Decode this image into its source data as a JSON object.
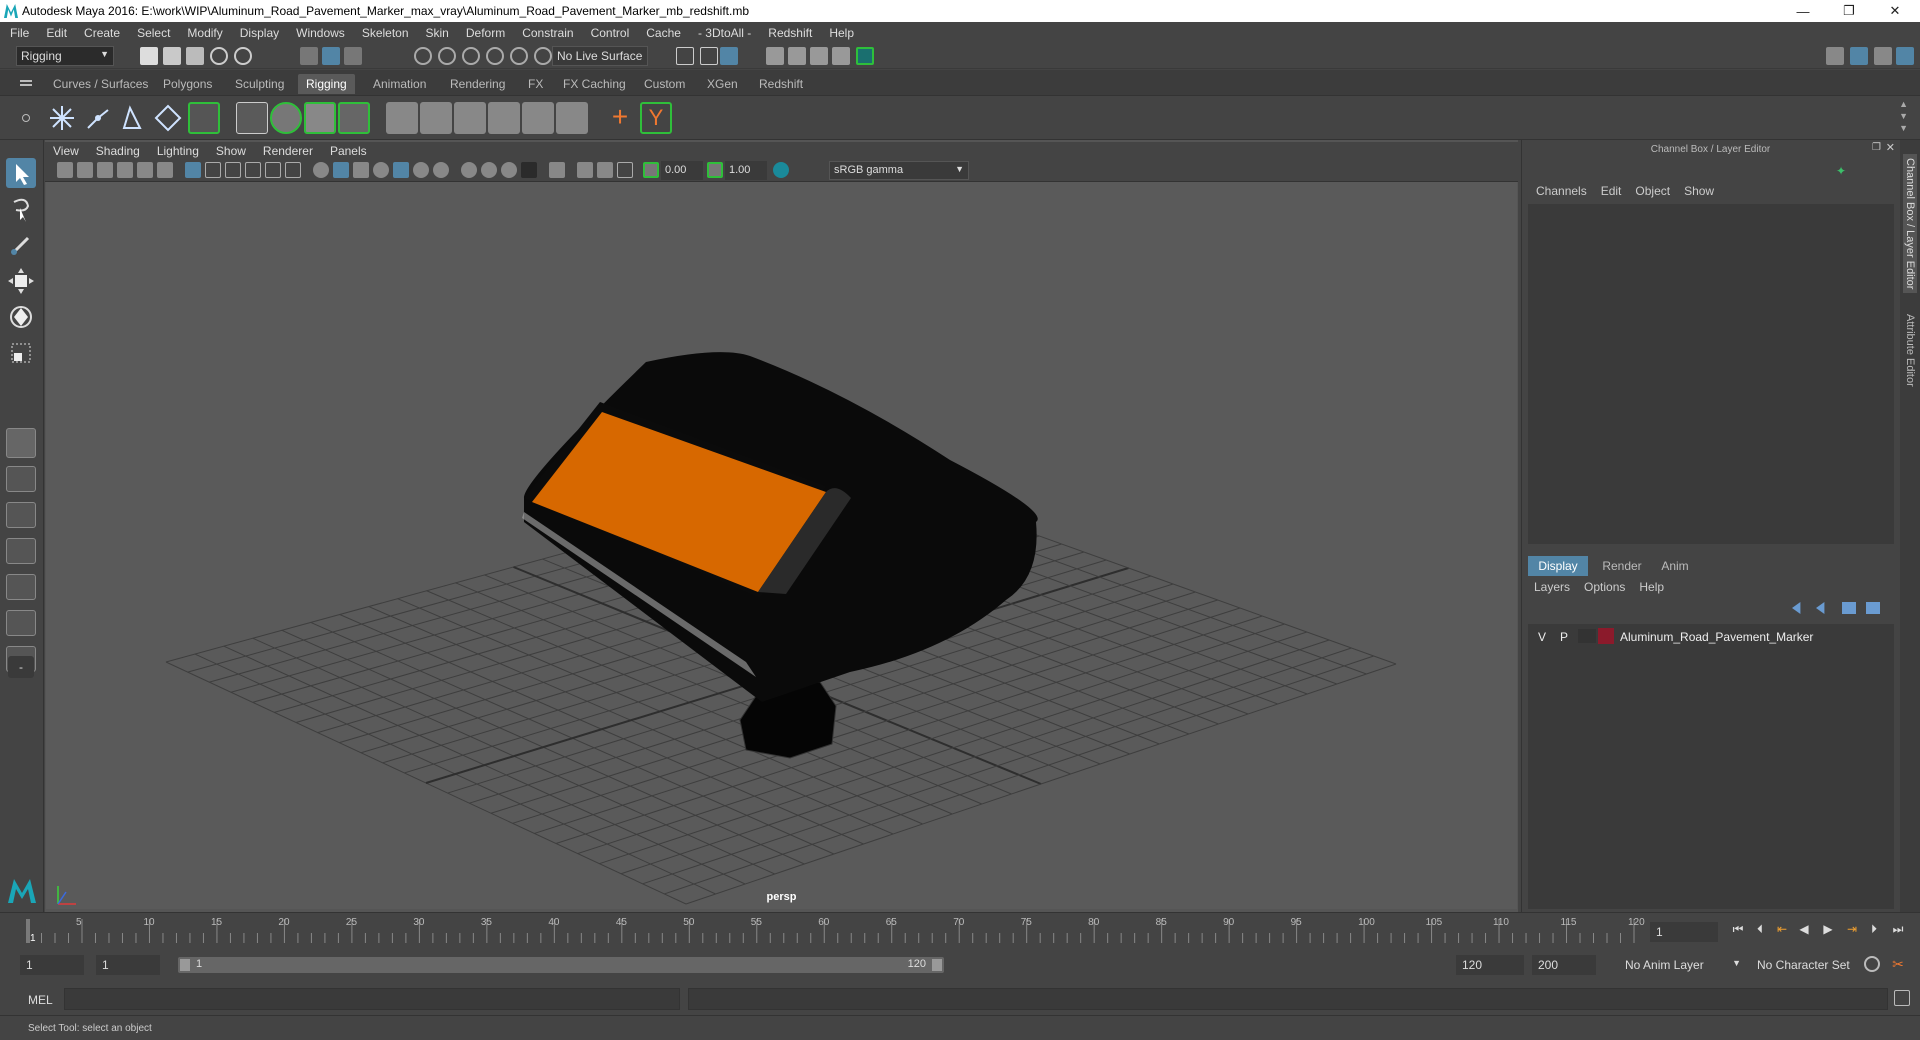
{
  "window": {
    "title": "Autodesk Maya 2016: E:\\work\\WIP\\Aluminum_Road_Pavement_Marker_max_vray\\Aluminum_Road_Pavement_Marker_mb_redshift.mb",
    "minimize": "—",
    "maximize": "❐",
    "close": "✕"
  },
  "menubar": [
    "File",
    "Edit",
    "Create",
    "Select",
    "Modify",
    "Display",
    "Windows",
    "Skeleton",
    "Skin",
    "Deform",
    "Constrain",
    "Control",
    "Cache",
    "- 3DtoAll -",
    "Redshift",
    "Help"
  ],
  "statusline": {
    "mode": "Rigging",
    "live_surface": "No Live Surface"
  },
  "shelf": {
    "tabs": [
      "Curves / Surfaces",
      "Polygons",
      "Sculpting",
      "Rigging",
      "Animation",
      "Rendering",
      "FX",
      "FX Caching",
      "Custom",
      "XGen",
      "Redshift"
    ],
    "active_tab": "Rigging"
  },
  "viewport": {
    "menu": [
      "View",
      "Shading",
      "Lighting",
      "Show",
      "Renderer",
      "Panels"
    ],
    "exposure": "0.00",
    "gamma": "1.00",
    "color_space": "sRGB gamma",
    "camera": "persp"
  },
  "channel_box": {
    "title": "Channel Box / Layer Editor",
    "menu": [
      "Channels",
      "Edit",
      "Object",
      "Show"
    ],
    "side_tabs": [
      "Channel Box / Layer Editor",
      "Attribute Editor"
    ]
  },
  "layer_editor": {
    "tabs": [
      "Display",
      "Render",
      "Anim"
    ],
    "active_tab": "Display",
    "menu": [
      "Layers",
      "Options",
      "Help"
    ],
    "layers": [
      {
        "v": "V",
        "p": "P",
        "color": "#8b1a2b",
        "name": "Aluminum_Road_Pavement_Marker"
      }
    ]
  },
  "timeline": {
    "ticks": [
      "1",
      "5",
      "10",
      "15",
      "20",
      "25",
      "30",
      "35",
      "40",
      "45",
      "50",
      "55",
      "60",
      "65",
      "70",
      "75",
      "80",
      "85",
      "90",
      "95",
      "100",
      "105",
      "110",
      "115",
      "120"
    ],
    "current_frame": "1"
  },
  "range": {
    "start": "1",
    "playback_start": "1",
    "slider_start": "1",
    "slider_end": "120",
    "playback_end": "120",
    "end": "200",
    "anim_layer": "No Anim Layer",
    "character_set": "No Character Set"
  },
  "command": {
    "label": "MEL"
  },
  "help_line": "Select Tool: select an object",
  "colors": {
    "accent": "#5285a6",
    "reflector": "#d76800",
    "layer_color": "#8b1a2b"
  }
}
